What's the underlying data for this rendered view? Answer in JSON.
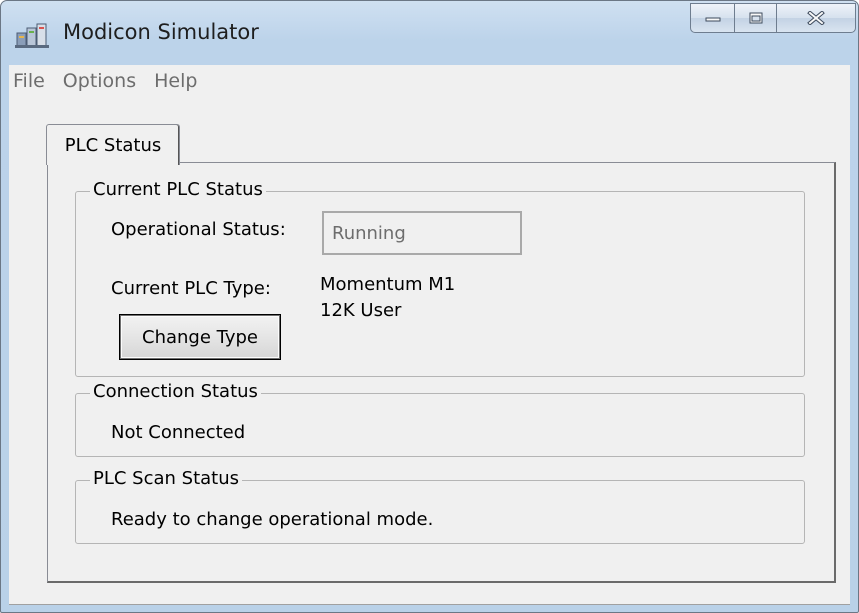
{
  "window": {
    "title": "Modicon Simulator",
    "icon": "plc-simulator-app-icon",
    "caption_buttons": [
      "minimize-icon",
      "maximize-icon",
      "close-icon"
    ]
  },
  "menubar": {
    "items": [
      {
        "label": "File"
      },
      {
        "label": "Options"
      },
      {
        "label": "Help"
      }
    ]
  },
  "tabs": [
    {
      "label": "PLC Status",
      "selected": true
    }
  ],
  "current_status": {
    "legend": "Current PLC Status",
    "operational_label": "Operational Status:",
    "operational_value": "Running",
    "type_label": "Current PLC Type:",
    "type_line1": "Momentum M1",
    "type_line2": "12K User",
    "change_type_button": "Change Type"
  },
  "connection_status": {
    "legend": "Connection Status",
    "value": "Not Connected"
  },
  "scan_status": {
    "legend": "PLC Scan Status",
    "value": "Ready to change operational mode."
  },
  "colors": {
    "frame": "#b9d1e8",
    "client": "#f0f0f0",
    "disabled_text": "#6d6d6d"
  }
}
